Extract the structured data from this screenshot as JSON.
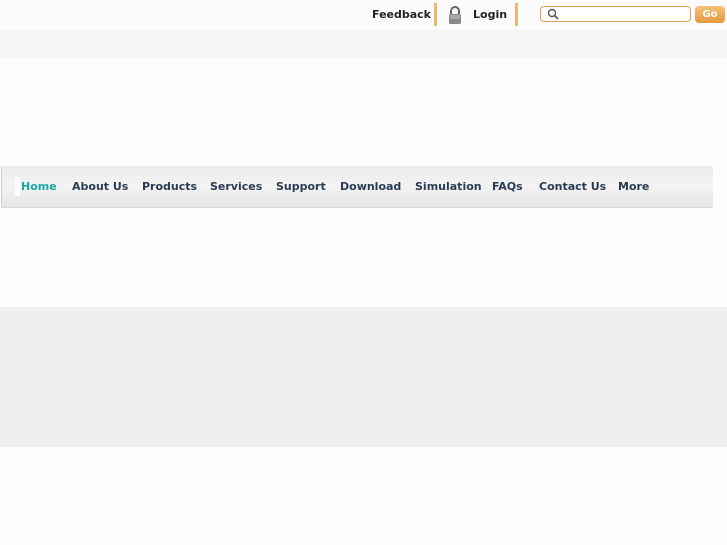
{
  "topbar": {
    "feedback_label": "Feedback",
    "login_label": "Login",
    "search_placeholder": "",
    "go_label": "Go"
  },
  "nav": {
    "items": [
      {
        "label": "Home",
        "active": true
      },
      {
        "label": "About Us"
      },
      {
        "label": "Products"
      },
      {
        "label": "Services"
      },
      {
        "label": "Support"
      },
      {
        "label": "Download"
      },
      {
        "label": "Simulation"
      },
      {
        "label": "FAQs"
      },
      {
        "label": "Contact Us"
      },
      {
        "label": "More"
      }
    ]
  },
  "colors": {
    "accent": "#f0b46a",
    "active_nav": "#1aa6a0",
    "nav_text": "#2a3b52"
  }
}
